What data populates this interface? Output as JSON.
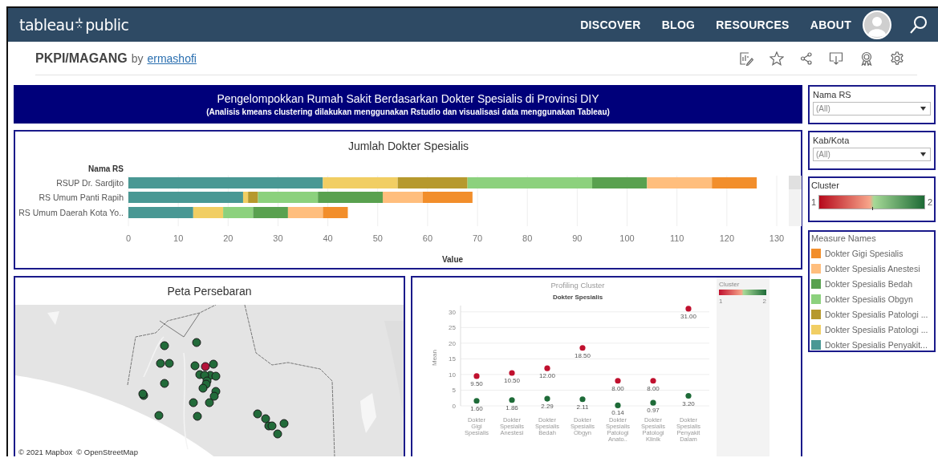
{
  "top_bar": {
    "logo": {
      "left": "tableau",
      "right": "public"
    },
    "nav": [
      "DISCOVER",
      "BLOG",
      "RESOURCES",
      "ABOUT"
    ]
  },
  "viz_header": {
    "title": "PKPI/MAGANG",
    "by": "by",
    "author": "ermashofi"
  },
  "banner": {
    "title": "Pengelompokkan Rumah Sakit Berdasarkan Dokter Spesialis di Provinsi DIY",
    "subtitle": "(Analisis kmeans clustering dilakukan menggunakan Rstudio dan visualisasi data menggunakan Tableau)"
  },
  "bar_panel": {
    "title": "Jumlah Dokter Spesialis",
    "chart_data": {
      "type": "bar",
      "orientation": "horizontal",
      "stacked": true,
      "xlabel": "Value",
      "ylabel": "Nama RS",
      "categories": [
        "RSUP Dr. Sardjito",
        "RS Umum Panti Rapih",
        "RS Umum Daerah Kota Yo.."
      ],
      "xlim": [
        0,
        130
      ],
      "grid": true,
      "xticks": [
        0,
        10,
        20,
        30,
        40,
        50,
        60,
        70,
        80,
        90,
        100,
        110,
        120,
        130
      ],
      "series": [
        {
          "name": "Dokter Gigi Spesialis",
          "color": "#f28e2b",
          "values": [
            9,
            10,
            5
          ]
        },
        {
          "name": "Dokter Spesialis Anestesi",
          "color": "#ffbe7d",
          "values": [
            13,
            8,
            7
          ]
        },
        {
          "name": "Dokter Spesialis Bedah",
          "color": "#59a14f",
          "values": [
            11,
            13,
            7
          ]
        },
        {
          "name": "Dokter Spesialis Obgyn",
          "color": "#8cd17d",
          "values": [
            25,
            12,
            6
          ]
        },
        {
          "name": "Dokter Spesialis Patologi ...",
          "color": "#b6992d",
          "values": [
            14,
            2,
            0
          ]
        },
        {
          "name": "Dokter Spesialis Patologi ...",
          "color": "#f1ce63",
          "values": [
            15,
            1,
            6
          ]
        },
        {
          "name": "Dokter Spesialis Penyakit...",
          "color": "#499894",
          "values": [
            39,
            23,
            13
          ]
        }
      ]
    }
  },
  "map_panel": {
    "title": "Peta Persebaran",
    "map": {
      "kind": "picture"
    },
    "attribution": [
      "© 2021 Mapbox",
      "© OpenStreetMap"
    ]
  },
  "scatter_panel": {
    "title": "Profiling Cluster",
    "chart_data": {
      "type": "scatter",
      "title": "Dokter Spesialis",
      "ylabel": "Mean",
      "categories": [
        "Dokter Gigi Spesialis",
        "Dokter Spesialis Anestesi",
        "Dokter Spesialis Bedah",
        "Dokter Spesialis Obgyn",
        "Dokter Spesialis Patologi Anato..",
        "Dokter Spesialis Patologi Klinik",
        "Dokter Spesialis Penyakit Dalam"
      ],
      "grid": true,
      "ylim": [
        0,
        32
      ],
      "yticks": [
        0,
        5,
        10,
        15,
        20,
        25,
        30
      ],
      "data_labels": true,
      "series": [
        {
          "name": "1",
          "color": "#c0102e",
          "values": [
            9.5,
            10.5,
            12.0,
            18.5,
            8.0,
            8.0,
            31.0
          ],
          "value_labels": [
            "9.50",
            "10.50",
            "12.00",
            "18.50",
            "8.00",
            "8.00",
            "31.00"
          ]
        },
        {
          "name": "2",
          "color": "#1e6b38",
          "values": [
            1.6,
            1.86,
            2.29,
            2.11,
            0.14,
            0.97,
            3.2
          ],
          "value_labels": [
            "1.60",
            "1.86",
            "2.29",
            "2.11",
            "0.14",
            "0.97",
            "3.20"
          ]
        }
      ]
    },
    "legend": {
      "title": "Cluster"
    }
  },
  "filters": [
    {
      "label": "Nama RS",
      "value": "(All)"
    },
    {
      "label": "Kab/Kota",
      "value": "(All)"
    }
  ],
  "cluster_legend": {
    "title": "Cluster",
    "min": "1",
    "max": "2"
  },
  "measure_legend": {
    "title": "Measure Names"
  }
}
